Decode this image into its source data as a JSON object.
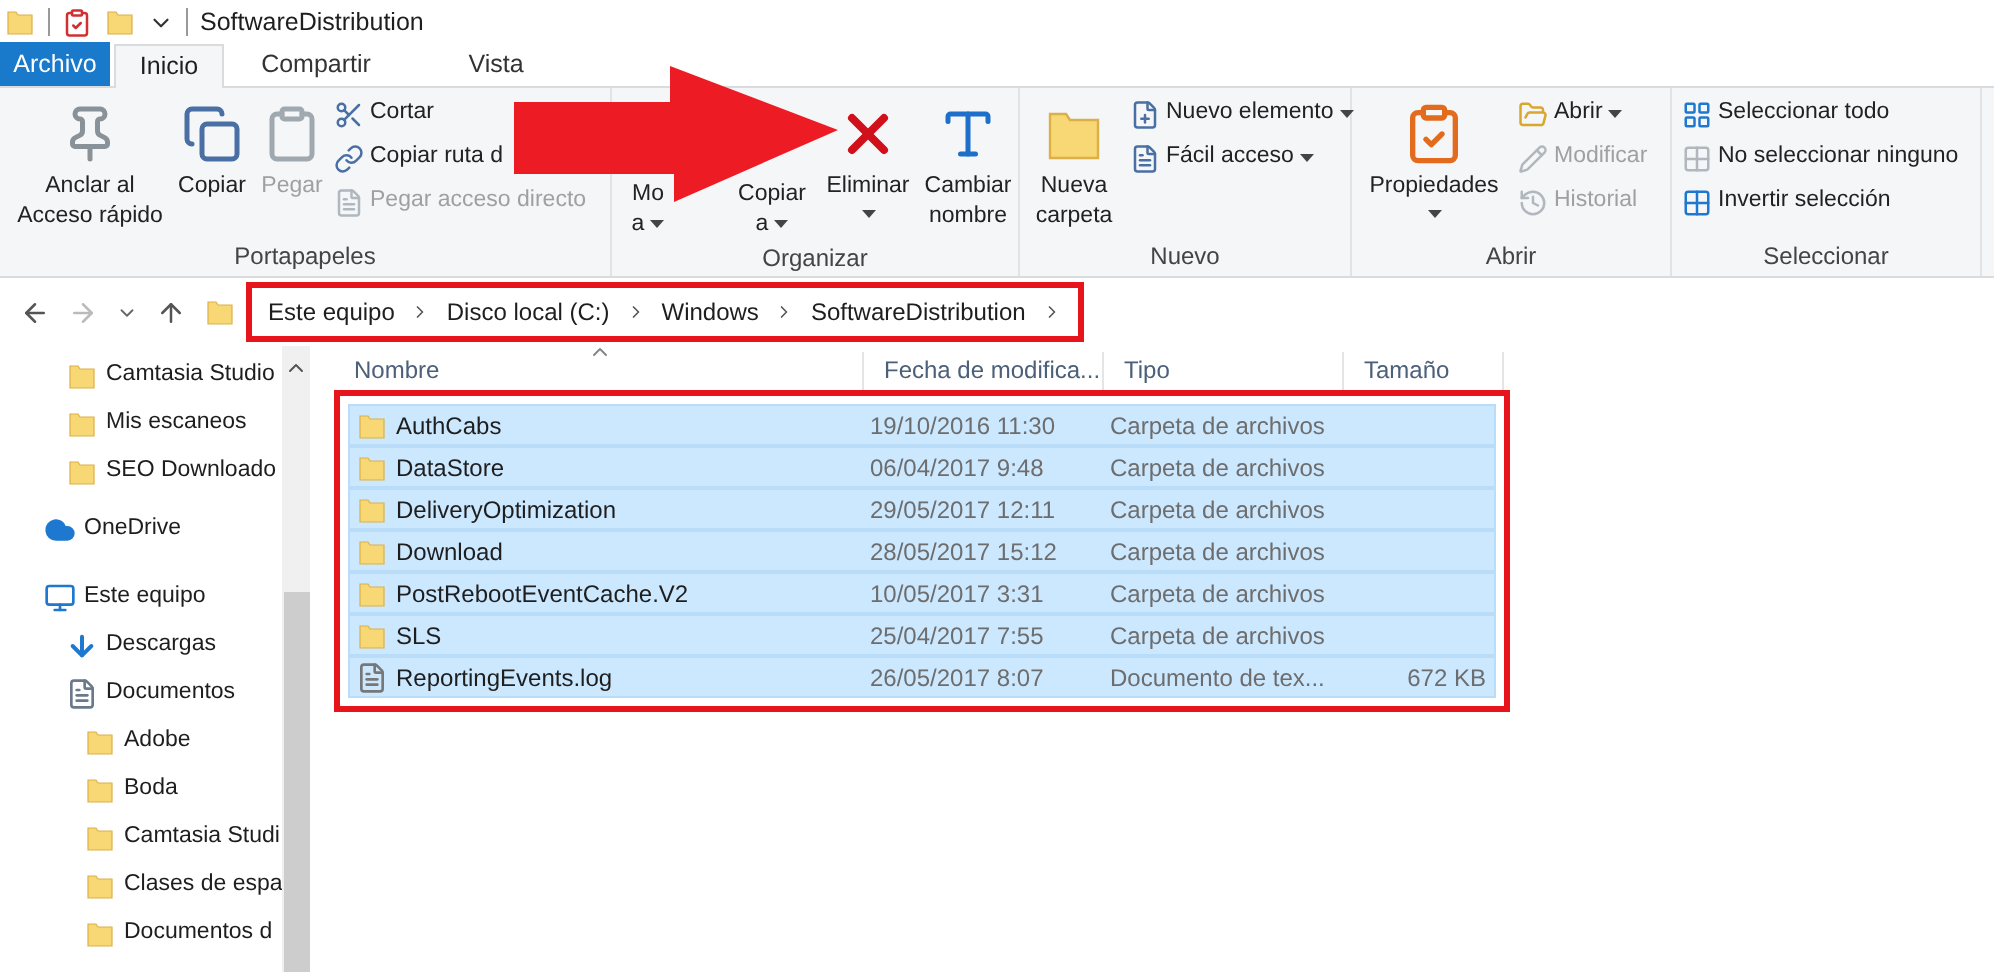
{
  "title_bar": {
    "title": "SoftwareDistribution"
  },
  "tabs": [
    {
      "label": "Archivo",
      "kind": "file",
      "selected": false
    },
    {
      "label": "Inicio",
      "kind": "tab",
      "selected": true
    },
    {
      "label": "Compartir",
      "kind": "tab",
      "selected": false
    },
    {
      "label": "Vista",
      "kind": "tab",
      "selected": false
    }
  ],
  "ribbon": {
    "groups": [
      {
        "name": "Portapapeles",
        "items": [
          {
            "kind": "large",
            "lines": [
              "Anclar al",
              "Acceso rápido"
            ],
            "disabled": false,
            "has_menu": false
          },
          {
            "kind": "large",
            "lines": [
              "Copiar"
            ],
            "disabled": false,
            "has_menu": false
          },
          {
            "kind": "large",
            "lines": [
              "Pegar"
            ],
            "disabled": true,
            "has_menu": false
          },
          {
            "kind": "stack",
            "entries": [
              {
                "label": "Cortar",
                "disabled": false,
                "has_menu": false
              },
              {
                "label": "Copiar ruta d",
                "disabled": false,
                "has_menu": false
              },
              {
                "label": "Pegar acceso directo",
                "disabled": true,
                "has_menu": false
              }
            ]
          }
        ]
      },
      {
        "name": "Organizar",
        "items": [
          {
            "kind": "large",
            "lines": [
              "Mo",
              "a"
            ],
            "disabled": false,
            "has_menu": true
          },
          {
            "kind": "large",
            "lines": [
              "Copiar",
              "a"
            ],
            "disabled": false,
            "has_menu": true
          },
          {
            "kind": "large",
            "lines": [
              "Eliminar"
            ],
            "disabled": false,
            "has_menu": true
          },
          {
            "kind": "large",
            "lines": [
              "Cambiar",
              "nombre"
            ],
            "disabled": false,
            "has_menu": false
          }
        ]
      },
      {
        "name": "Nuevo",
        "items": [
          {
            "kind": "large",
            "lines": [
              "Nueva",
              "carpeta"
            ],
            "disabled": false,
            "has_menu": false
          },
          {
            "kind": "stack",
            "entries": [
              {
                "label": "Nuevo elemento",
                "disabled": false,
                "has_menu": true
              },
              {
                "label": "Fácil acceso",
                "disabled": false,
                "has_menu": true
              }
            ]
          }
        ]
      },
      {
        "name": "Abrir",
        "items": [
          {
            "kind": "large",
            "lines": [
              "Propiedades"
            ],
            "disabled": false,
            "has_menu": true
          },
          {
            "kind": "stack",
            "entries": [
              {
                "label": "Abrir",
                "disabled": false,
                "has_menu": true
              },
              {
                "label": "Modificar",
                "disabled": true,
                "has_menu": false
              },
              {
                "label": "Historial",
                "disabled": true,
                "has_menu": false
              }
            ]
          }
        ]
      },
      {
        "name": "Seleccionar",
        "items": [
          {
            "kind": "stack",
            "entries": [
              {
                "label": "Seleccionar todo",
                "disabled": false,
                "has_menu": false
              },
              {
                "label": "No seleccionar ninguno",
                "disabled": false,
                "has_menu": false
              },
              {
                "label": "Invertir selección",
                "disabled": false,
                "has_menu": false
              }
            ]
          }
        ]
      }
    ]
  },
  "annotation_arrow": true,
  "address_bar": {
    "highlighted": true,
    "crumbs": [
      "Este equipo",
      "Disco local (C:)",
      "Windows",
      "SoftwareDistribution"
    ]
  },
  "sidebar": {
    "items": [
      {
        "label": "Camtasia Studio",
        "kind": "folder"
      },
      {
        "label": "Mis escaneos",
        "kind": "folder"
      },
      {
        "label": "SEO Downloado",
        "kind": "folder"
      },
      {
        "label": "OneDrive",
        "kind": "cloud"
      },
      {
        "label": "Este equipo",
        "kind": "pc",
        "children": [
          {
            "label": "Descargas",
            "kind": "download"
          },
          {
            "label": "Documentos",
            "kind": "docs",
            "children": [
              {
                "label": "Adobe",
                "kind": "folder"
              },
              {
                "label": "Boda",
                "kind": "folder"
              },
              {
                "label": "Camtasia Studi",
                "kind": "folder"
              },
              {
                "label": "Clases de espa",
                "kind": "folder"
              },
              {
                "label": "Documentos d",
                "kind": "folder"
              }
            ]
          }
        ]
      }
    ]
  },
  "file_list": {
    "highlighted": true,
    "columns": [
      "Nombre",
      "Fecha de modifica...",
      "Tipo",
      "Tamaño"
    ],
    "rows": [
      {
        "name": "AuthCabs",
        "date": "19/10/2016 11:30",
        "type": "Carpeta de archivos",
        "kind": "folder",
        "selected": true
      },
      {
        "name": "DataStore",
        "date": "06/04/2017 9:48",
        "type": "Carpeta de archivos",
        "kind": "folder",
        "selected": true
      },
      {
        "name": "DeliveryOptimization",
        "date": "29/05/2017 12:11",
        "type": "Carpeta de archivos",
        "kind": "folder",
        "selected": true
      },
      {
        "name": "Download",
        "date": "28/05/2017 15:12",
        "type": "Carpeta de archivos",
        "kind": "folder",
        "selected": true
      },
      {
        "name": "PostRebootEventCache.V2",
        "date": "10/05/2017 3:31",
        "type": "Carpeta de archivos",
        "kind": "folder",
        "selected": true
      },
      {
        "name": "SLS",
        "date": "25/04/2017 7:55",
        "type": "Carpeta de archivos",
        "kind": "folder",
        "selected": true
      },
      {
        "name": "ReportingEvents.log",
        "date": "26/05/2017 8:07",
        "type": "Documento de tex...",
        "size": "672 KB",
        "kind": "file",
        "selected": true
      }
    ]
  }
}
